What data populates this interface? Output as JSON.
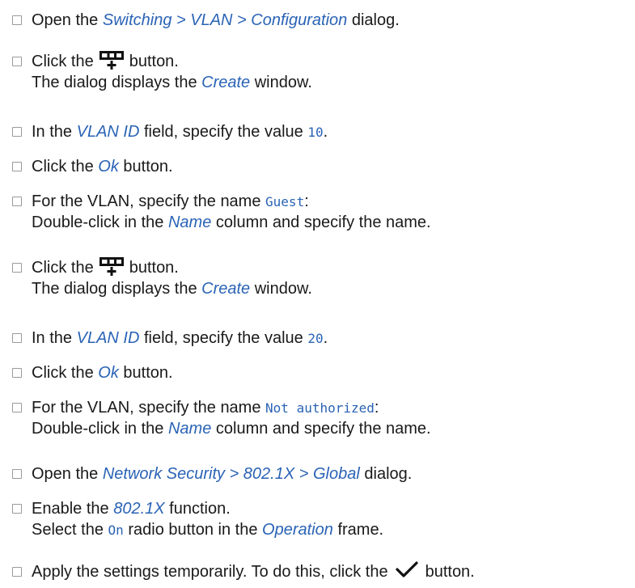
{
  "steps": [
    {
      "t1": "Open the ",
      "r1": "Switching > VLAN > Configuration",
      "t2": " dialog."
    },
    {
      "t1": "Click the ",
      "icon": "add-table-row-icon",
      "t2": " button.",
      "t3": "The dialog displays the ",
      "r1": "Create",
      "t4": " window."
    },
    {
      "t1": "In the ",
      "r1": "VLAN ID",
      "t2": " field, specify the value ",
      "v1": "10",
      "t3": "."
    },
    {
      "t1": "Click the ",
      "r1": "Ok",
      "t2": " button."
    },
    {
      "t1": "For the VLAN, specify the name ",
      "v1": "Guest",
      "t2": ":",
      "t3": "Double-click in the ",
      "r1": "Name",
      "t4": " column and specify the name."
    },
    {
      "t1": "Click the ",
      "icon": "add-table-row-icon",
      "t2": " button.",
      "t3": "The dialog displays the ",
      "r1": "Create",
      "t4": " window."
    },
    {
      "t1": "In the ",
      "r1": "VLAN ID",
      "t2": " field, specify the value ",
      "v1": "20",
      "t3": "."
    },
    {
      "t1": "Click the ",
      "r1": "Ok",
      "t2": " button."
    },
    {
      "t1": "For the VLAN, specify the name ",
      "v1": "Not authorized",
      "t2": ":",
      "t3": "Double-click in the ",
      "r1": "Name",
      "t4": " column and specify the name."
    },
    {
      "t1": "Open the ",
      "r1": "Network Security > 802.1X > Global",
      "t2": " dialog."
    },
    {
      "t1": "Enable the ",
      "r1": "802.1X",
      "t2": " function.",
      "t3": "Select the ",
      "v1": "On",
      "t4": " radio button in the ",
      "r2": "Operation",
      "t5": " frame."
    },
    {
      "t1": "Apply the settings temporarily. To do this, click the ",
      "icon": "checkmark-icon",
      "t2": " button."
    }
  ],
  "colors": {
    "reference": "#2a63b5",
    "checkbox_border": "#9a9a9a",
    "text": "#1a1a1a"
  }
}
